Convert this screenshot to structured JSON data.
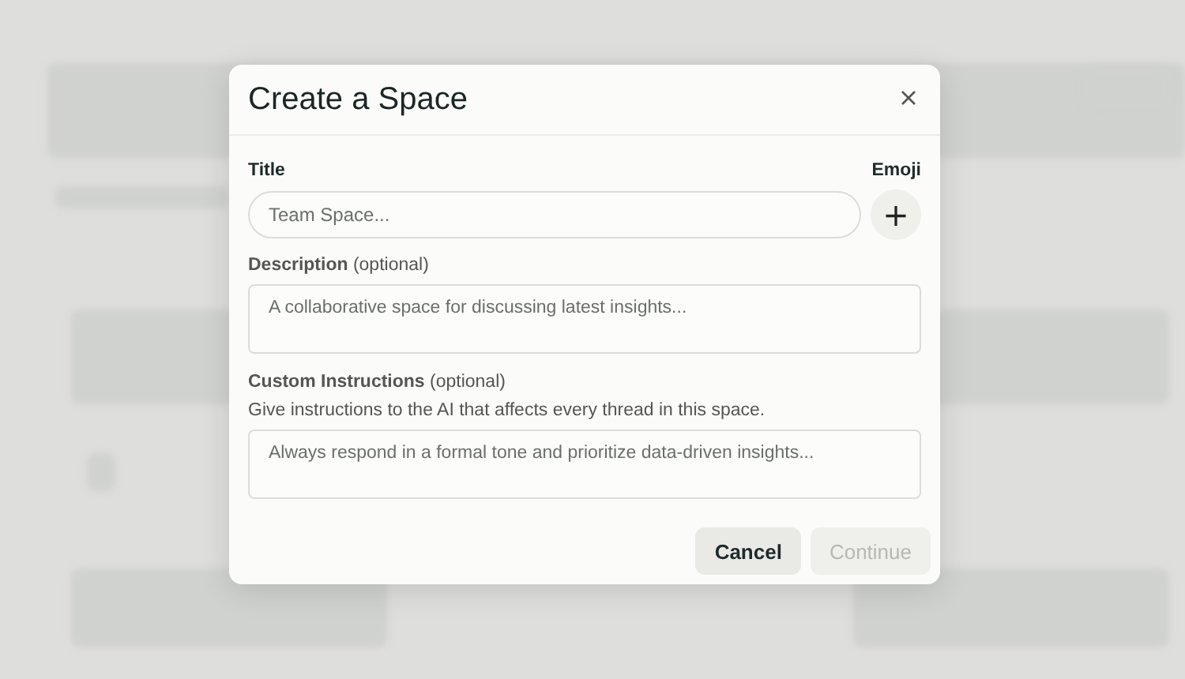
{
  "dialog": {
    "title": "Create a Space",
    "fields": [
      {
        "kind": "title",
        "label": "Title",
        "placeholder": "Team Space..."
      },
      {
        "kind": "textarea",
        "label": "**Description** (optional)",
        "placeholder": "A collaborative space for discussing latest insights..."
      },
      {
        "kind": "textarea",
        "label": "**Custom Instructions** (optional)",
        "help": "Give instructions to the AI that affects every thread in this space.",
        "placeholder": "Always respond in a formal tone and prioritize data-driven insights..."
      }
    ],
    "emoji": {
      "label": "Emoji",
      "icon": "+"
    },
    "buttons": [
      {
        "kind": "secondary",
        "label": "Cancel",
        "disabled": false
      },
      {
        "kind": "primary",
        "label": "Continue",
        "disabled": true
      }
    ]
  }
}
